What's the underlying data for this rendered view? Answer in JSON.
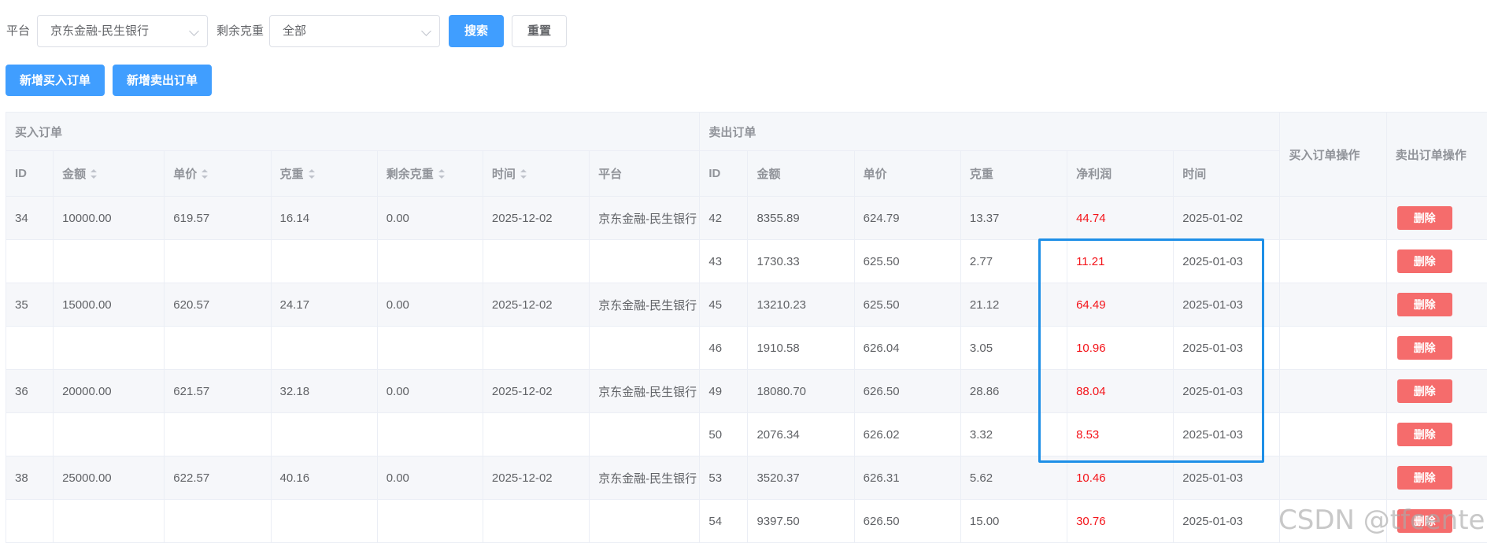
{
  "filters": {
    "platform_label": "平台",
    "platform_value": "京东金融-民生银行",
    "remaining_label": "剩余克重",
    "remaining_value": "全部",
    "search_label": "搜索",
    "reset_label": "重置"
  },
  "actions": {
    "add_buy_label": "新增买入订单",
    "add_sell_label": "新增卖出订单"
  },
  "table": {
    "group_buy": "买入订单",
    "group_sell": "卖出订单",
    "buy_op_header": "买入订单操作",
    "sell_op_header": "卖出订单操作",
    "buy_columns": [
      "ID",
      "金额",
      "单价",
      "克重",
      "剩余克重",
      "时间",
      "平台"
    ],
    "sell_columns": [
      "ID",
      "金额",
      "单价",
      "克重",
      "净利润",
      "时间"
    ],
    "delete_label": "删除",
    "rows": [
      {
        "buy": [
          "34",
          "10000.00",
          "619.57",
          "16.14",
          "0.00",
          "2025-12-02",
          "京东金融-民生银行"
        ],
        "sell": [
          "42",
          "8355.89",
          "624.79",
          "13.37",
          "44.74",
          "2025-01-02"
        ]
      },
      {
        "buy": [
          "",
          "",
          "",
          "",
          "",
          "",
          ""
        ],
        "sell": [
          "43",
          "1730.33",
          "625.50",
          "2.77",
          "11.21",
          "2025-01-03"
        ]
      },
      {
        "buy": [
          "35",
          "15000.00",
          "620.57",
          "24.17",
          "0.00",
          "2025-12-02",
          "京东金融-民生银行"
        ],
        "sell": [
          "45",
          "13210.23",
          "625.50",
          "21.12",
          "64.49",
          "2025-01-03"
        ]
      },
      {
        "buy": [
          "",
          "",
          "",
          "",
          "",
          "",
          ""
        ],
        "sell": [
          "46",
          "1910.58",
          "626.04",
          "3.05",
          "10.96",
          "2025-01-03"
        ]
      },
      {
        "buy": [
          "36",
          "20000.00",
          "621.57",
          "32.18",
          "0.00",
          "2025-12-02",
          "京东金融-民生银行"
        ],
        "sell": [
          "49",
          "18080.70",
          "626.50",
          "28.86",
          "88.04",
          "2025-01-03"
        ]
      },
      {
        "buy": [
          "",
          "",
          "",
          "",
          "",
          "",
          ""
        ],
        "sell": [
          "50",
          "2076.34",
          "626.02",
          "3.32",
          "8.53",
          "2025-01-03"
        ]
      },
      {
        "buy": [
          "38",
          "25000.00",
          "622.57",
          "40.16",
          "0.00",
          "2025-12-02",
          "京东金融-民生银行"
        ],
        "sell": [
          "53",
          "3520.37",
          "626.31",
          "5.62",
          "10.46",
          "2025-01-03"
        ]
      },
      {
        "buy": [
          "",
          "",
          "",
          "",
          "",
          "",
          ""
        ],
        "sell": [
          "54",
          "9397.50",
          "626.50",
          "15.00",
          "30.76",
          "2025-01-03"
        ]
      }
    ]
  },
  "watermark": "CSDN @tfcenter",
  "colors": {
    "primary": "#409eff",
    "danger": "#f56c6c",
    "profit": "#f4141a",
    "highlight": "#1e8fe7"
  }
}
